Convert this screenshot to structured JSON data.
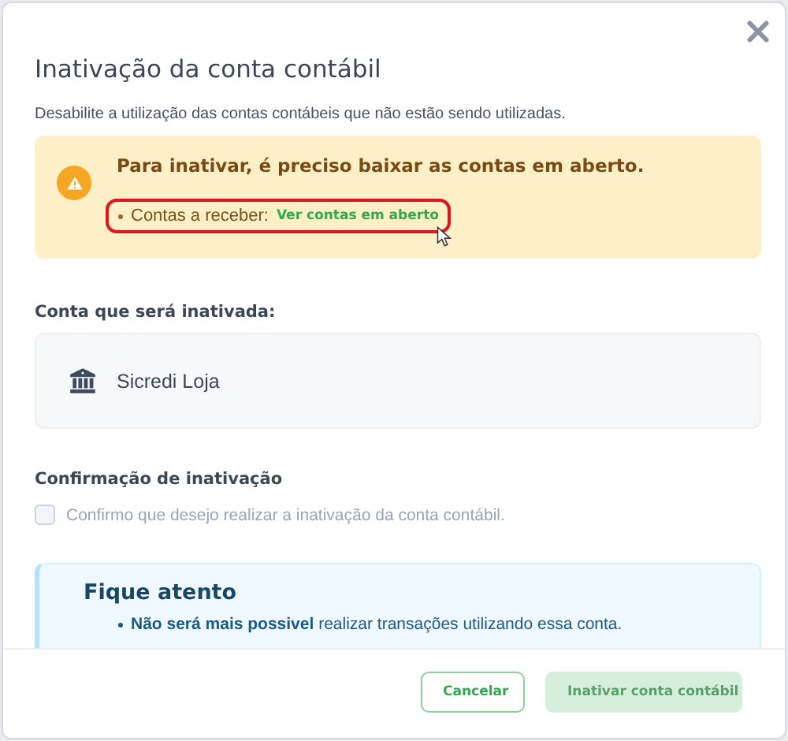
{
  "dialog": {
    "title": "Inativação da conta contábil",
    "subtitle": "Desabilite a utilização das contas contábeis que não estão sendo utilizadas."
  },
  "alert": {
    "title": "Para inativar, é preciso baixar as contas em aberto.",
    "items": [
      {
        "label": "Contas a receber:",
        "link": "Ver contas em aberto",
        "highlighted": true
      }
    ]
  },
  "account": {
    "label": "Conta que será inativada:",
    "name": "Sicredi Loja"
  },
  "confirmation": {
    "title": "Confirmação de inativação",
    "label": "Confirmo que desejo realizar a inativação da conta contábil.",
    "checked": false
  },
  "notice": {
    "title": "Fique atento",
    "items": [
      "**Não será mais possivel** realizar transações utilizando essa conta."
    ]
  },
  "buttons": [
    {
      "label": "Cancelar",
      "kind": "secondary",
      "disabled": false
    },
    {
      "label": "Inativar conta contábil",
      "kind": "primary",
      "disabled": true
    }
  ]
}
